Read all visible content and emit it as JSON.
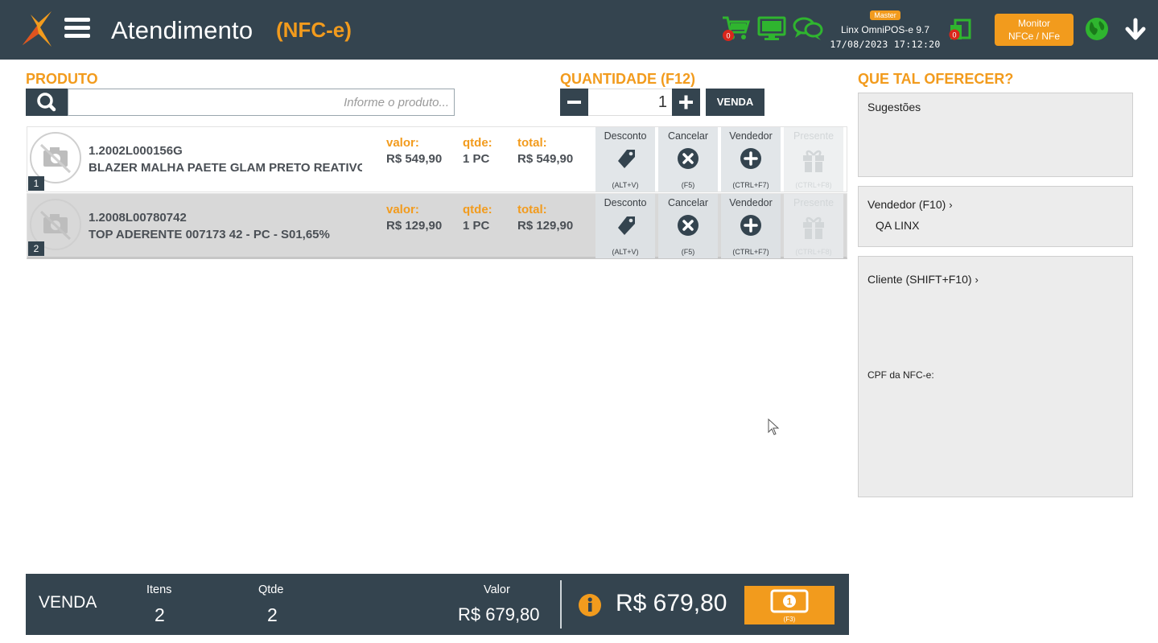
{
  "header": {
    "title": "Atendimento",
    "subtitle": "(NFC-e)",
    "cart_badge": "0",
    "sync_badge": "0",
    "master_badge": "Master",
    "version": "Linx OmniPOS-e  9.7",
    "datetime": "17/08/2023 17:12:20",
    "monitor_line1": "Monitor",
    "monitor_line2": "NFCe / NFe",
    "icons": [
      "menu-icon",
      "cart-icon",
      "monitor-screen-icon",
      "chat-icon",
      "sync-icon",
      "globe-icon",
      "download-arrow-icon"
    ]
  },
  "product": {
    "label": "PRODUTO",
    "placeholder": "Informe o produto..."
  },
  "quantity": {
    "label": "QUANTIDADE (F12)",
    "value": "1",
    "sale_button": "VENDA"
  },
  "items": [
    {
      "index": "1",
      "code": "1.2002L000156G",
      "description": "BLAZER MALHA PAETE GLAM PRETO REATIVO",
      "valor_label": "valor:",
      "valor": "R$ 549,90",
      "qtde_label": "qtde:",
      "qtde": "1 PC",
      "total_label": "total:",
      "total": "R$ 549,90"
    },
    {
      "index": "2",
      "code": "1.2008L00780742",
      "description": "TOP ADERENTE 007173 42 - PC - S01,65%",
      "valor_label": "valor:",
      "valor": "R$ 129,90",
      "qtde_label": "qtde:",
      "qtde": "1 PC",
      "total_label": "total:",
      "total": "R$ 129,90"
    }
  ],
  "actions": {
    "desconto": "Desconto",
    "desconto_key": "(ALT+V)",
    "cancelar": "Cancelar",
    "cancelar_key": "(F5)",
    "vendedor": "Vendedor",
    "vendedor_key": "(CTRL+F7)",
    "presente": "Presente",
    "presente_key": "(CTRL+F8)"
  },
  "suggestions": {
    "label": "QUE TAL OFERECER?",
    "sugestoes": "Sugestões",
    "vendedor_title": "Vendedor (F10)",
    "vendedor_value": "QA LINX",
    "cliente_title": "Cliente (SHIFT+F10)",
    "cpf_label": "CPF da NFC-e:"
  },
  "footer": {
    "mode": "VENDA",
    "itens_label": "Itens",
    "itens_value": "2",
    "qtde_label": "Qtde",
    "qtde_value": "2",
    "valor_label": "Valor",
    "valor_value": "R$ 679,80",
    "total": "R$ 679,80",
    "pay_key": "(F3)"
  },
  "colors": {
    "accent": "#f29b1d",
    "dark": "#34444f",
    "green": "#2fb52f",
    "red": "#d9261c"
  }
}
